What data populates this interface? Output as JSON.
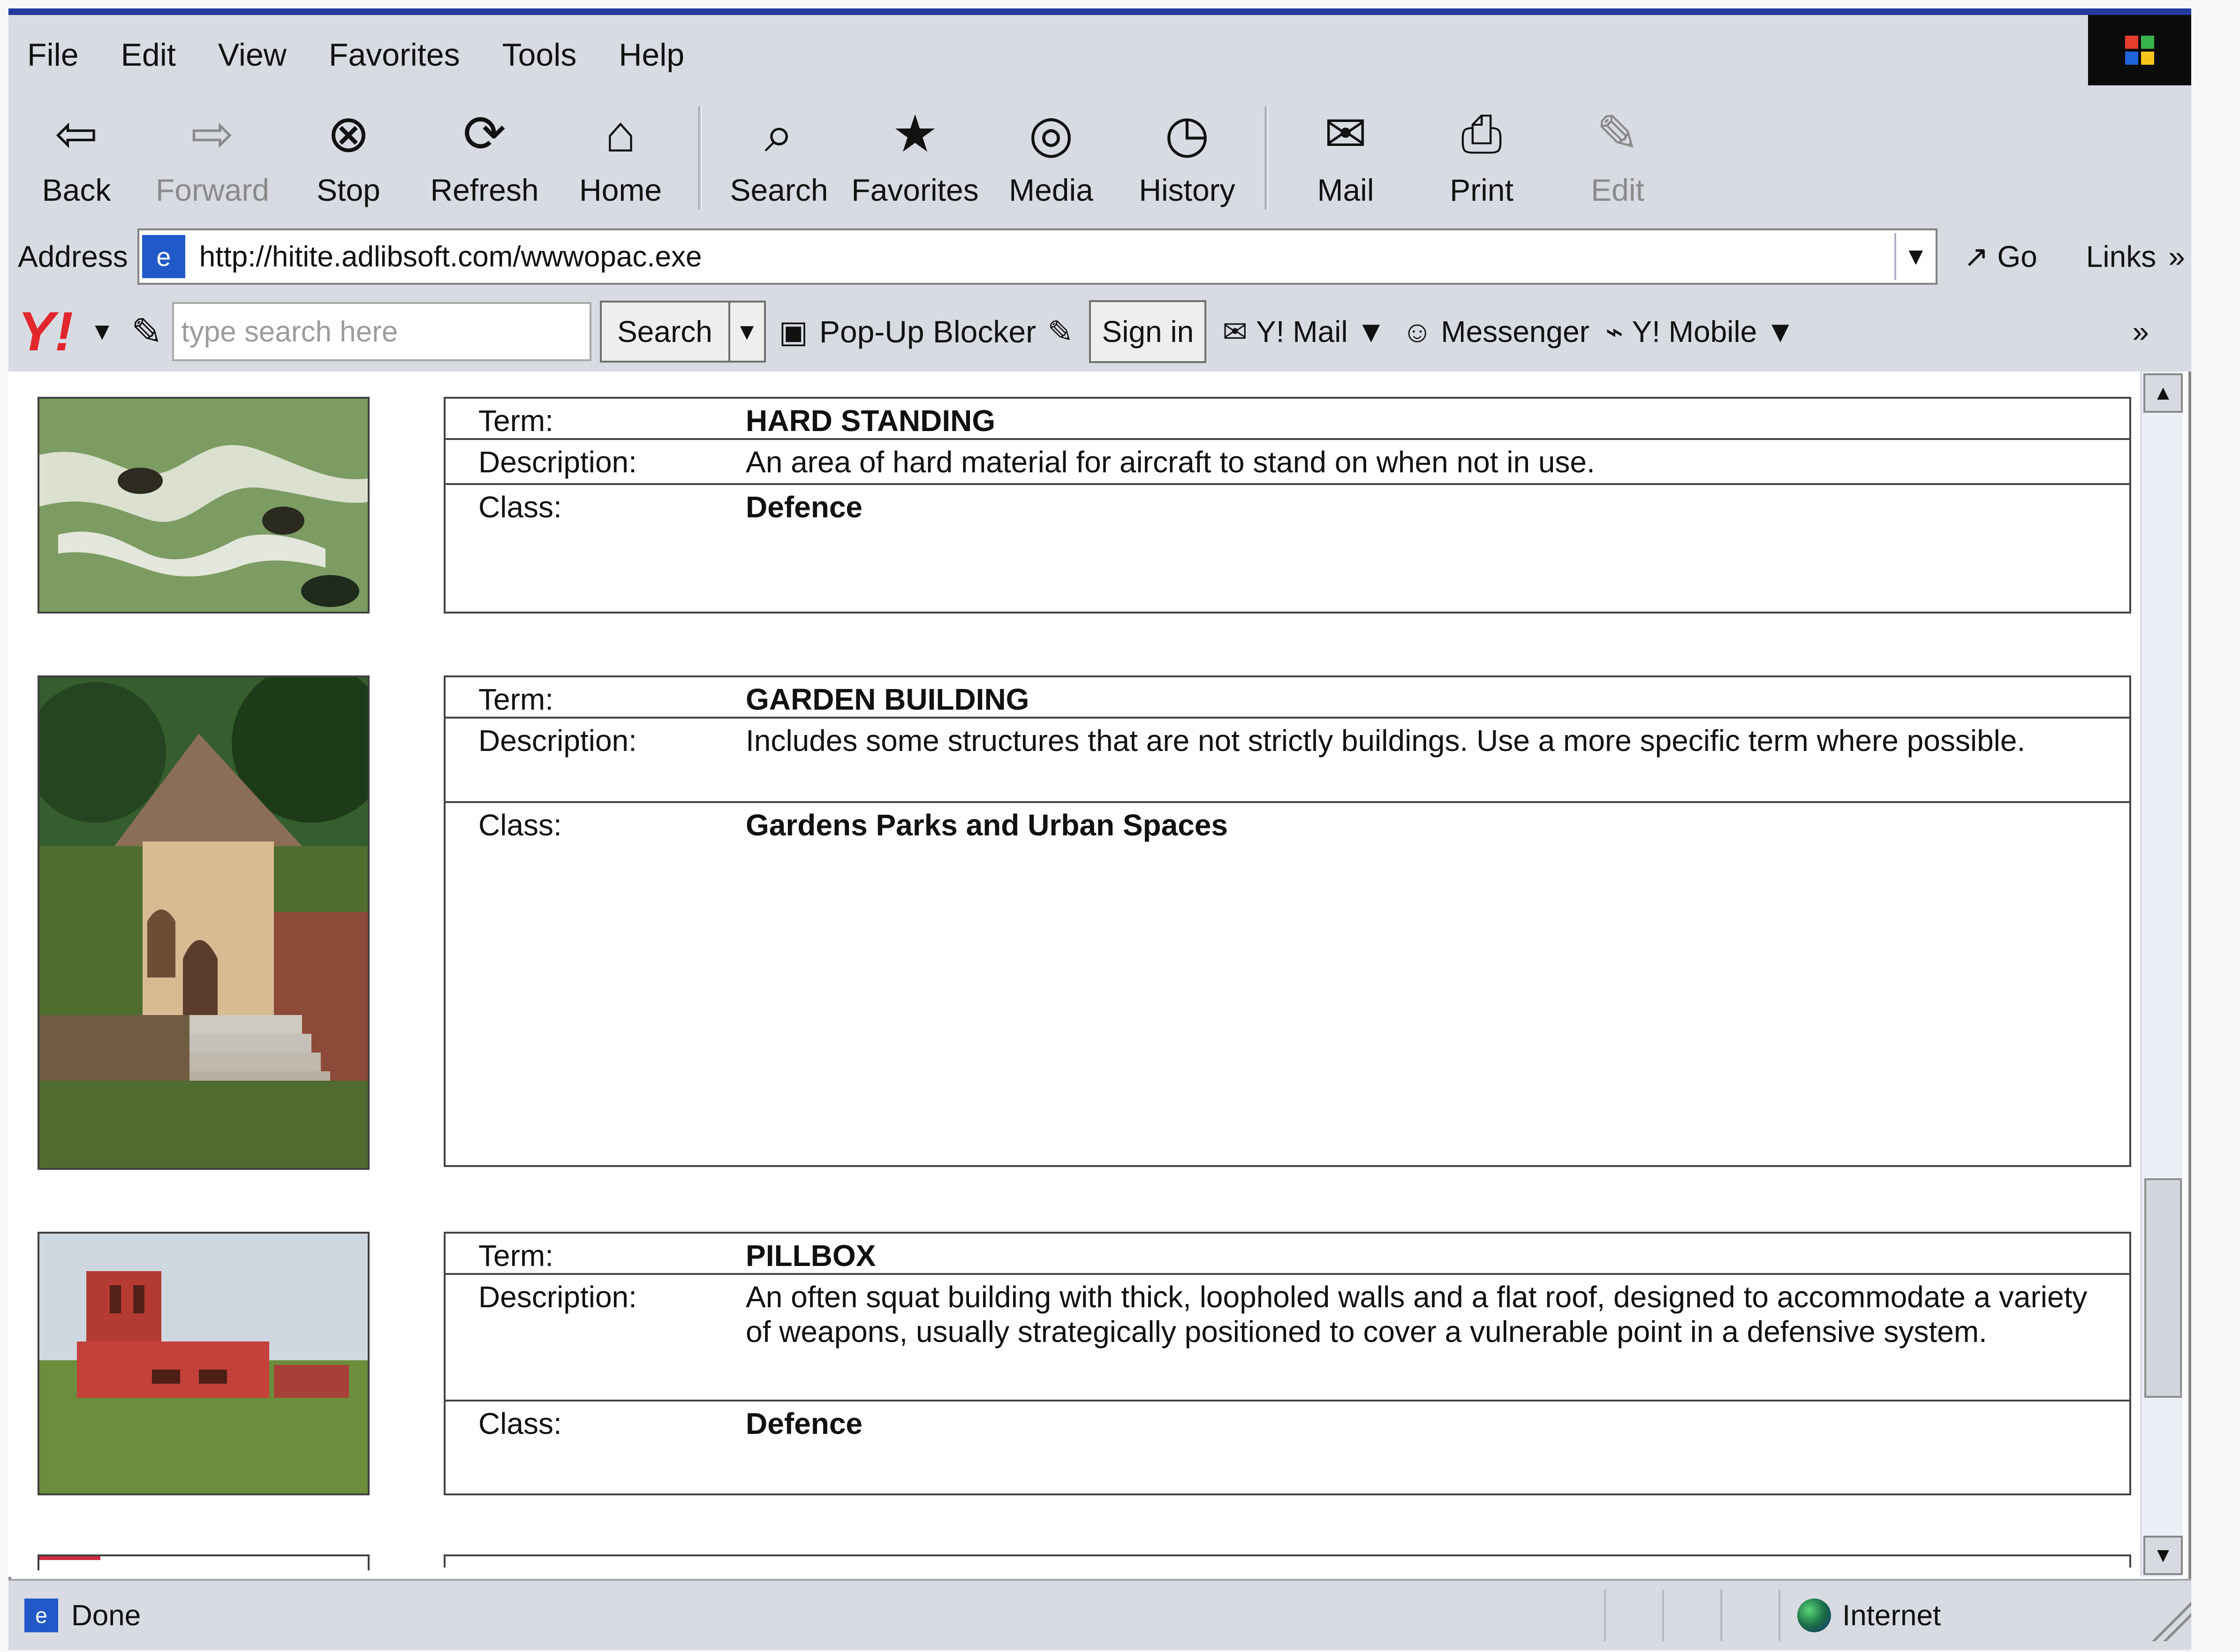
{
  "browser": {
    "menu": [
      "File",
      "Edit",
      "View",
      "Favorites",
      "Tools",
      "Help"
    ],
    "toolbar": [
      {
        "label": "Back",
        "icon": "back-arrow-icon"
      },
      {
        "label": "Forward",
        "icon": "forward-arrow-icon"
      },
      {
        "label": "Stop",
        "icon": "stop-icon"
      },
      {
        "label": "Refresh",
        "icon": "refresh-icon"
      },
      {
        "label": "Home",
        "icon": "home-icon"
      },
      {
        "label": "Search",
        "icon": "search-icon"
      },
      {
        "label": "Favorites",
        "icon": "favorites-icon"
      },
      {
        "label": "Media",
        "icon": "media-icon"
      },
      {
        "label": "History",
        "icon": "history-icon"
      },
      {
        "label": "Mail",
        "icon": "mail-icon"
      },
      {
        "label": "Print",
        "icon": "print-icon"
      },
      {
        "label": "Edit",
        "icon": "edit-icon"
      }
    ],
    "address": {
      "label": "Address",
      "url": "http://hitite.adlibsoft.com/wwwopac.exe",
      "go": "Go",
      "links": "Links",
      "overflow": "»"
    },
    "yahoo": {
      "logo": "Y!",
      "placeholder": "type search here",
      "search": "Search",
      "popup": "Pop-Up Blocker",
      "signin": "Sign in",
      "mail": "Y! Mail",
      "messenger": "Messenger",
      "mobile": "Y! Mobile",
      "overflow": "»"
    },
    "status": {
      "done": "Done",
      "zone": "Internet"
    }
  },
  "entries": [
    {
      "term_label": "Term:",
      "term": "HARD STANDING",
      "description_label": "Description:",
      "description": "An area of hard material for aircraft to stand on when not in use.",
      "class_label": "Class:",
      "class": "Defence"
    },
    {
      "term_label": "Term:",
      "term": "GARDEN BUILDING",
      "description_label": "Description:",
      "description": "Includes some structures that are not strictly buildings. Use a more specific term where possible.",
      "class_label": "Class:",
      "class": "Gardens Parks and Urban Spaces"
    },
    {
      "term_label": "Term:",
      "term": "PILLBOX",
      "description_label": "Description:",
      "description": "An often squat building with thick, loopholed walls and a flat roof, designed to accommodate a variety of weapons, usually strategically positioned to cover a vulnerable point in a defensive system.",
      "class_label": "Class:",
      "class": "Defence"
    }
  ]
}
